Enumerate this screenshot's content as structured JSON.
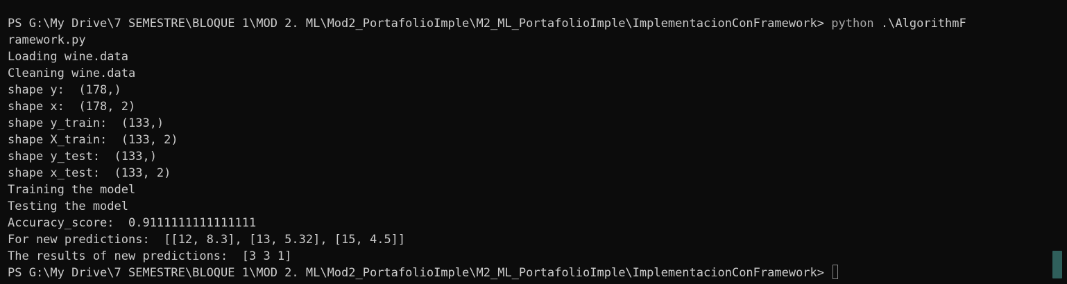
{
  "terminal": {
    "prompt_line_1": {
      "prompt": "PS G:\\My Drive\\7 SEMESTRE\\BLOQUE 1\\MOD 2. ML\\Mod2_PortafolioImple\\M2_ML_PortafolioImple\\ImplementacionConFramework> ",
      "command": "python",
      "args_part1": " .\\AlgorithmF",
      "args_part2": "ramework.py"
    },
    "output": [
      "Loading wine.data",
      "Cleaning wine.data",
      "shape y:  (178,)",
      "shape x:  (178, 2)",
      "shape y_train:  (133,)",
      "shape X_train:  (133, 2)",
      "shape y_test:  (133,)",
      "shape x_test:  (133, 2)",
      "Training the model",
      "Testing the model",
      "Accuracy_score:  0.9111111111111111",
      "For new predictions:  [[12, 8.3], [13, 5.32], [15, 4.5]]",
      "The results of new predictions:  [3 3 1]"
    ],
    "prompt_line_2": {
      "prompt": "PS G:\\My Drive\\7 SEMESTRE\\BLOQUE 1\\MOD 2. ML\\Mod2_PortafolioImple\\M2_ML_PortafolioImple\\ImplementacionConFramework> "
    },
    "colors": {
      "background": "#0c0c0c",
      "text": "#cccccc",
      "command": "#a8a8a8",
      "scrollbar": "#2f5f5b"
    }
  }
}
